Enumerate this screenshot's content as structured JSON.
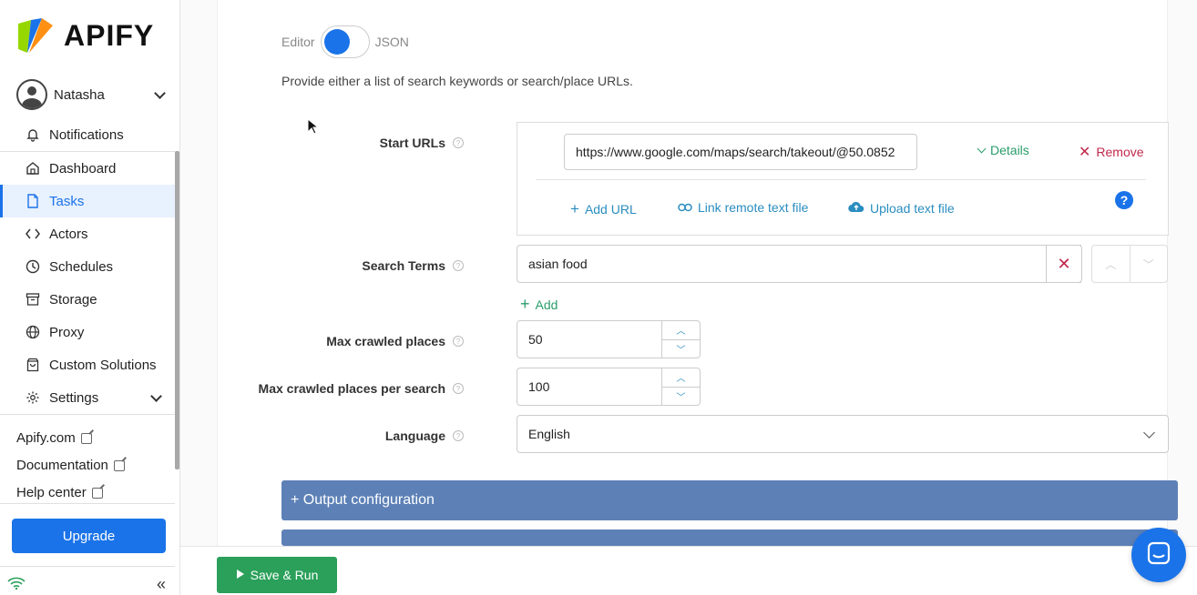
{
  "brand": {
    "name": "APIFY",
    "colors": {
      "green": "#97d700",
      "blue": "#1a73e8",
      "orange": "#ff9013"
    }
  },
  "user": {
    "name": "Natasha"
  },
  "nav": {
    "notifications": "Notifications",
    "items": [
      {
        "label": "Dashboard",
        "icon": "home-icon"
      },
      {
        "label": "Tasks",
        "icon": "file-icon",
        "active": true
      },
      {
        "label": "Actors",
        "icon": "code-icon"
      },
      {
        "label": "Schedules",
        "icon": "clock-icon"
      },
      {
        "label": "Storage",
        "icon": "archive-icon"
      },
      {
        "label": "Proxy",
        "icon": "globe-icon"
      },
      {
        "label": "Custom Solutions",
        "icon": "bag-icon"
      },
      {
        "label": "Settings",
        "icon": "gear-icon"
      }
    ]
  },
  "external_links": [
    "Apify.com",
    "Documentation",
    "Help center"
  ],
  "upgrade_label": "Upgrade",
  "editor": {
    "left_label": "Editor",
    "right_label": "JSON"
  },
  "hint": "Provide either a list of search keywords or search/place URLs.",
  "start_urls": {
    "label": "Start URLs",
    "value": "https://www.google.com/maps/search/takeout/@50.0852",
    "details_label": "Details",
    "remove_label": "Remove",
    "add_url_label": "Add URL",
    "link_remote_label": "Link remote text file",
    "upload_label": "Upload text file"
  },
  "search_terms": {
    "label": "Search Terms",
    "value": "asian food",
    "add_label": "Add"
  },
  "max_crawled_places": {
    "label": "Max crawled places",
    "value": "50"
  },
  "max_crawled_per_search": {
    "label": "Max crawled places per search",
    "value": "100"
  },
  "language": {
    "label": "Language",
    "value": "English"
  },
  "sections": {
    "output_configuration": "+ Output configuration"
  },
  "save_run_label": "Save & Run"
}
